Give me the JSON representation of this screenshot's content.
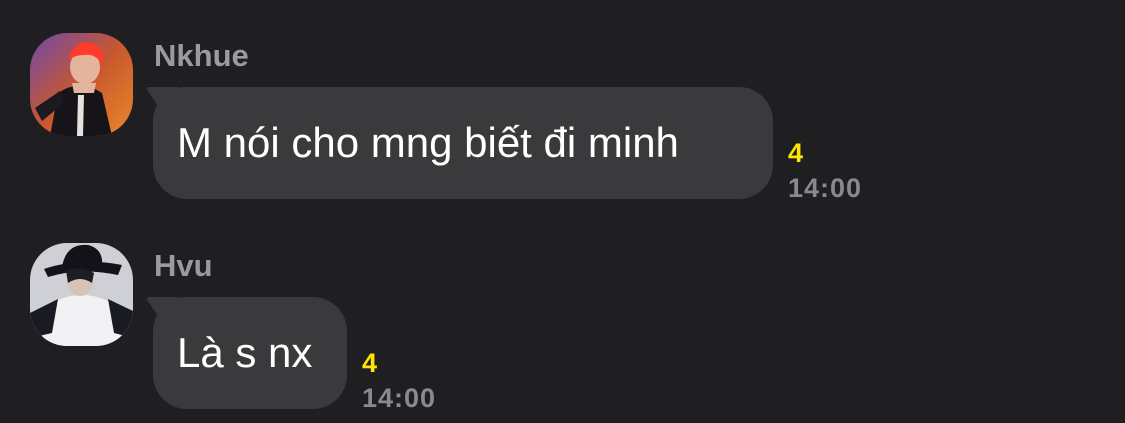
{
  "messages": [
    {
      "sender": "Nkhue",
      "text": "M nói cho mng biết đi minh",
      "read_count": "4",
      "time": "14:00",
      "avatar_icon": "avatar-red-hair-icon"
    },
    {
      "sender": "Hvu",
      "text": "Là s nx",
      "read_count": "4",
      "time": "14:00",
      "avatar_icon": "avatar-black-hat-icon"
    }
  ],
  "colors": {
    "background": "#1f1f21",
    "bubble": "#3a3a3d",
    "sender_name": "#9b9b9f",
    "read_count": "#ffe600",
    "timestamp": "#8a8a8e",
    "message_text": "#ffffff"
  }
}
